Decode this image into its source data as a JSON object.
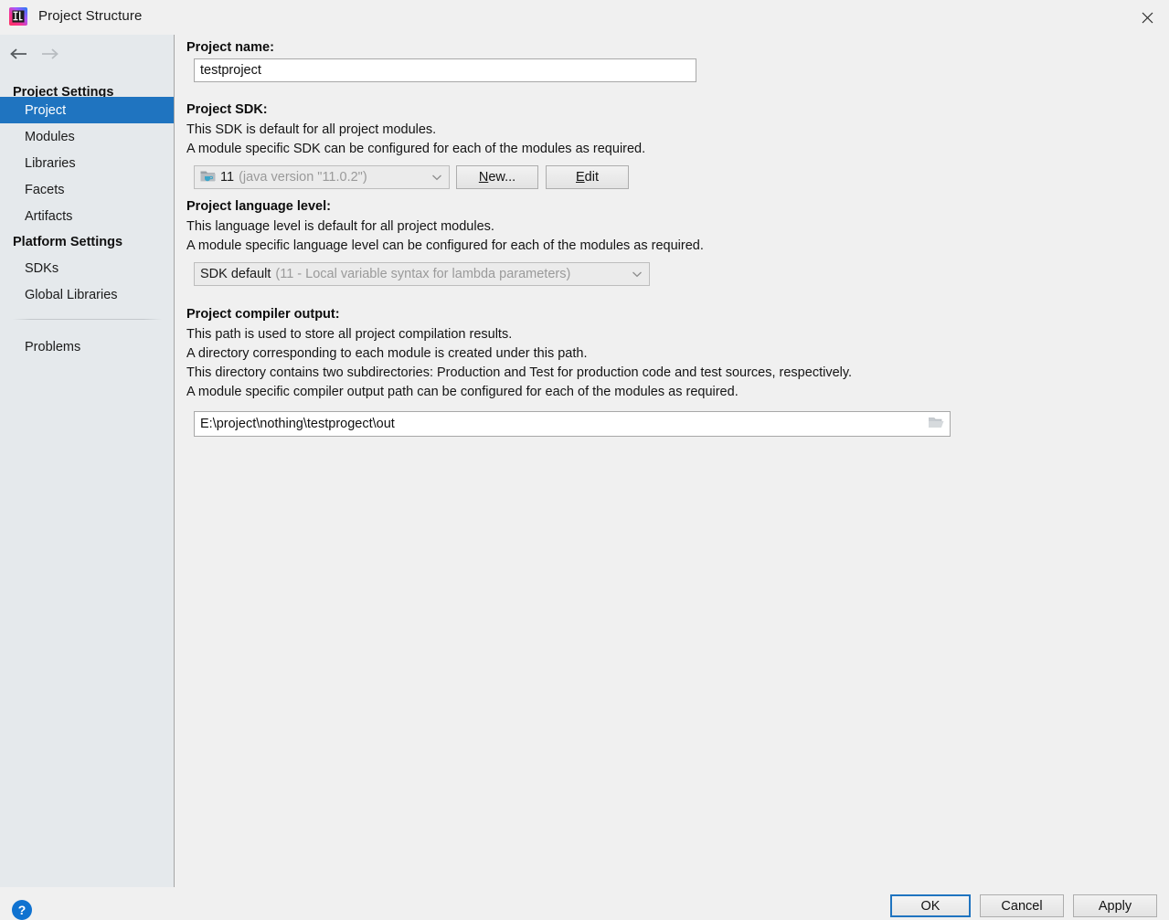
{
  "window": {
    "title": "Project Structure",
    "app_icon": "intellij-idea-logo",
    "close_icon": "close-icon"
  },
  "sidebar": {
    "nav": {
      "back_icon": "arrow-left-icon",
      "forward_icon": "arrow-right-icon"
    },
    "groups": [
      {
        "label": "Project Settings"
      },
      {
        "label": "Platform Settings"
      }
    ],
    "items": [
      {
        "label": "Project",
        "selected": true
      },
      {
        "label": "Modules",
        "selected": false
      },
      {
        "label": "Libraries",
        "selected": false
      },
      {
        "label": "Facets",
        "selected": false
      },
      {
        "label": "Artifacts",
        "selected": false
      },
      {
        "label": "SDKs",
        "selected": false
      },
      {
        "label": "Global Libraries",
        "selected": false
      },
      {
        "label": "Problems",
        "selected": false
      }
    ]
  },
  "main": {
    "project_name": {
      "label": "Project name:",
      "value": "testproject",
      "placeholder": ""
    },
    "project_sdk": {
      "label": "Project SDK:",
      "description_line1": "This SDK is default for all project modules.",
      "description_line2": "A module specific SDK can be configured for each of the modules as required.",
      "combo_icon": "java-sdk-folder-icon",
      "combo_value": "11",
      "combo_detail": "(java version \"11.0.2\")",
      "dropdown_icon": "chevron-down-icon",
      "new_button": "New...",
      "new_button_mnemonic": "N",
      "edit_button": "Edit",
      "edit_button_mnemonic": "E"
    },
    "language_level": {
      "label": "Project language level:",
      "description_line1": "This language level is default for all project modules.",
      "description_line2": "A module specific language level can be configured for each of the modules as required.",
      "combo_value": "SDK default",
      "combo_detail": "(11 - Local variable syntax for lambda parameters)",
      "dropdown_icon": "chevron-down-icon"
    },
    "compiler_output": {
      "label": "Project compiler output:",
      "description_line1": "This path is used to store all project compilation results.",
      "description_line2": "A directory corresponding to each module is created under this path.",
      "description_line3": "This directory contains two subdirectories: Production and Test for production code and test sources, respectively.",
      "description_line4": "A module specific compiler output path can be configured for each of the modules as required.",
      "value": "E:\\project\\nothing\\testprogect\\out",
      "browse_icon": "folder-open-icon"
    }
  },
  "footer": {
    "help_label": "?",
    "help_icon": "help-circle-icon",
    "ok_label": "OK",
    "cancel_label": "Cancel",
    "apply_label": "Apply"
  },
  "colors": {
    "accent": "#1f74c0",
    "sidebar_bg": "#e5e9ec",
    "panel_bg": "#f0f0f0",
    "help_blue": "#0f72d0"
  }
}
